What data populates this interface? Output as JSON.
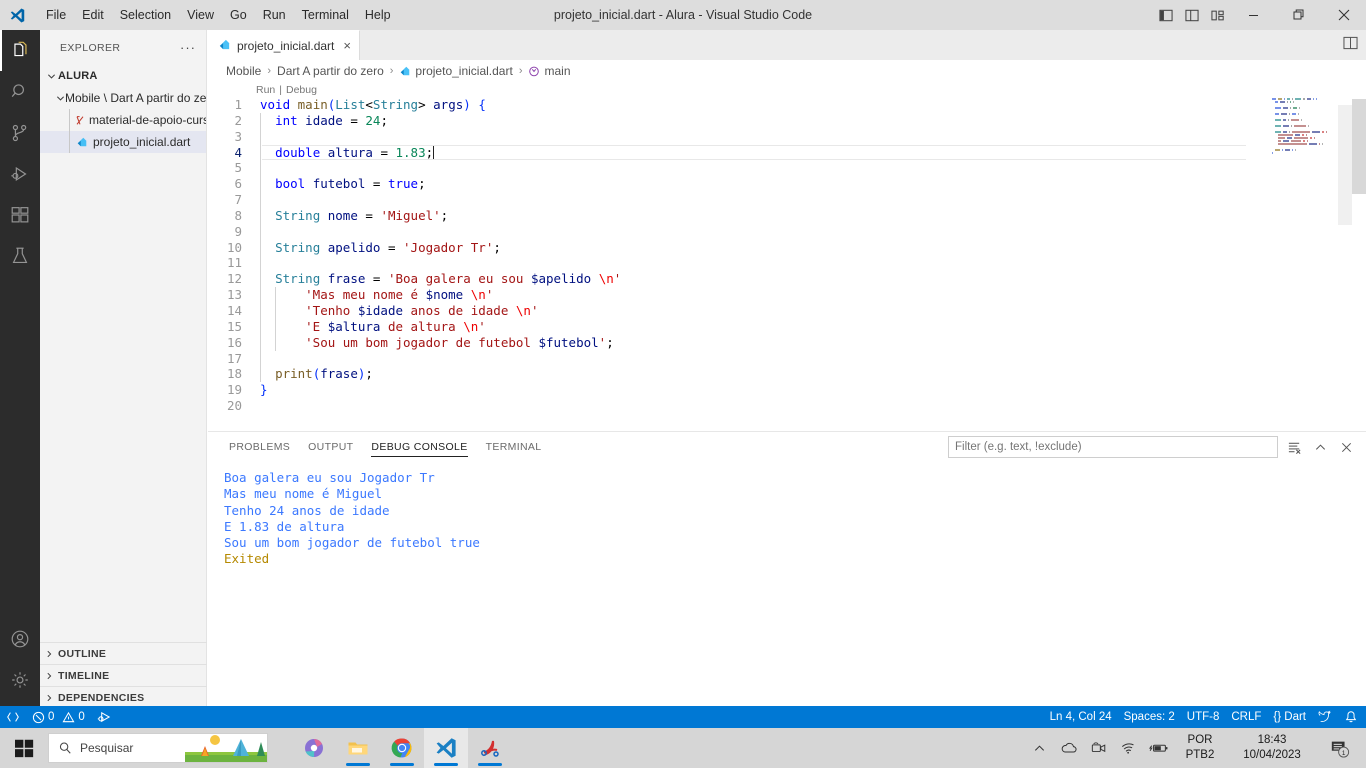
{
  "titlebar": {
    "title": "projeto_inicial.dart - Alura - Visual Studio Code",
    "logo_icon": "vscode-logo-icon",
    "menus": [
      "File",
      "Edit",
      "Selection",
      "View",
      "Go",
      "Run",
      "Terminal",
      "Help"
    ],
    "layout_icons": [
      "toggle-primary-sidebar-icon",
      "toggle-panel-icon",
      "toggle-secondary-sidebar-icon",
      "customize-layout-icon"
    ],
    "window_controls": [
      "minimize-icon",
      "maximize-icon",
      "close-icon"
    ]
  },
  "activitybar": {
    "items": [
      {
        "name": "explorer",
        "icon": "files-icon",
        "active": true
      },
      {
        "name": "search",
        "icon": "search-icon",
        "active": false
      },
      {
        "name": "source-control",
        "icon": "source-control-icon",
        "active": false
      },
      {
        "name": "run-and-debug",
        "icon": "run-debug-icon",
        "active": false
      },
      {
        "name": "extensions",
        "icon": "extensions-icon",
        "active": false
      },
      {
        "name": "testing",
        "icon": "beaker-icon",
        "active": false
      }
    ],
    "bottom": [
      {
        "name": "accounts",
        "icon": "account-icon"
      },
      {
        "name": "manage",
        "icon": "gear-icon"
      }
    ]
  },
  "sidebar": {
    "header_title": "EXPLORER",
    "header_more": "···",
    "root": "ALURA",
    "folder": "Mobile \\ Dart A partir do ze...",
    "files": [
      {
        "label": "material-de-apoio-curso-...",
        "icon": "pdf-icon",
        "selected": false
      },
      {
        "label": "projeto_inicial.dart",
        "icon": "dart-icon",
        "selected": true
      }
    ],
    "sections": [
      "OUTLINE",
      "TIMELINE",
      "DEPENDENCIES"
    ]
  },
  "editor": {
    "tab": {
      "label": "projeto_inicial.dart",
      "icon": "dart-icon",
      "close": "×"
    },
    "split_icon": "split-editor-icon",
    "breadcrumb": [
      "Mobile",
      "Dart A partir do zero",
      "projeto_inicial.dart",
      "main"
    ],
    "breadcrumb_file_icon": "dart-icon",
    "breadcrumb_symbol_icon": "symbol-method-icon",
    "codelens": {
      "run": "Run",
      "sep": "|",
      "debug": "Debug"
    },
    "current_line": 4,
    "lines": [
      {
        "n": 1,
        "indent": 0,
        "tokens": [
          {
            "t": "void",
            "c": "key"
          },
          {
            "t": " ",
            "c": "plain"
          },
          {
            "t": "main",
            "c": "fn"
          },
          {
            "t": "(",
            "c": "brkt1"
          },
          {
            "t": "List",
            "c": "type"
          },
          {
            "t": "<",
            "c": "op"
          },
          {
            "t": "String",
            "c": "type"
          },
          {
            "t": "> ",
            "c": "op"
          },
          {
            "t": "args",
            "c": "var"
          },
          {
            "t": ")",
            "c": "brkt1"
          },
          {
            "t": " ",
            "c": "plain"
          },
          {
            "t": "{",
            "c": "brkt1"
          }
        ]
      },
      {
        "n": 2,
        "indent": 1,
        "tokens": [
          {
            "t": "  ",
            "c": "plain"
          },
          {
            "t": "int",
            "c": "key"
          },
          {
            "t": " ",
            "c": "plain"
          },
          {
            "t": "idade",
            "c": "var"
          },
          {
            "t": " ",
            "c": "plain"
          },
          {
            "t": "=",
            "c": "op"
          },
          {
            "t": " ",
            "c": "plain"
          },
          {
            "t": "24",
            "c": "num"
          },
          {
            "t": ";",
            "c": "plain"
          }
        ]
      },
      {
        "n": 3,
        "indent": 1,
        "tokens": []
      },
      {
        "n": 4,
        "indent": 1,
        "tokens": [
          {
            "t": "  ",
            "c": "plain"
          },
          {
            "t": "double",
            "c": "key"
          },
          {
            "t": " ",
            "c": "plain"
          },
          {
            "t": "altura",
            "c": "var"
          },
          {
            "t": " ",
            "c": "plain"
          },
          {
            "t": "=",
            "c": "op"
          },
          {
            "t": " ",
            "c": "plain"
          },
          {
            "t": "1.83",
            "c": "num"
          },
          {
            "t": ";",
            "c": "plain"
          }
        ]
      },
      {
        "n": 5,
        "indent": 1,
        "tokens": []
      },
      {
        "n": 6,
        "indent": 1,
        "tokens": [
          {
            "t": "  ",
            "c": "plain"
          },
          {
            "t": "bool",
            "c": "key"
          },
          {
            "t": " ",
            "c": "plain"
          },
          {
            "t": "futebol",
            "c": "var"
          },
          {
            "t": " ",
            "c": "plain"
          },
          {
            "t": "=",
            "c": "op"
          },
          {
            "t": " ",
            "c": "plain"
          },
          {
            "t": "true",
            "c": "key"
          },
          {
            "t": ";",
            "c": "plain"
          }
        ]
      },
      {
        "n": 7,
        "indent": 1,
        "tokens": []
      },
      {
        "n": 8,
        "indent": 1,
        "tokens": [
          {
            "t": "  ",
            "c": "plain"
          },
          {
            "t": "String",
            "c": "type"
          },
          {
            "t": " ",
            "c": "plain"
          },
          {
            "t": "nome",
            "c": "var"
          },
          {
            "t": " ",
            "c": "plain"
          },
          {
            "t": "=",
            "c": "op"
          },
          {
            "t": " ",
            "c": "plain"
          },
          {
            "t": "'Miguel'",
            "c": "str"
          },
          {
            "t": ";",
            "c": "plain"
          }
        ]
      },
      {
        "n": 9,
        "indent": 1,
        "tokens": []
      },
      {
        "n": 10,
        "indent": 1,
        "tokens": [
          {
            "t": "  ",
            "c": "plain"
          },
          {
            "t": "String",
            "c": "type"
          },
          {
            "t": " ",
            "c": "plain"
          },
          {
            "t": "apelido",
            "c": "var"
          },
          {
            "t": " ",
            "c": "plain"
          },
          {
            "t": "=",
            "c": "op"
          },
          {
            "t": " ",
            "c": "plain"
          },
          {
            "t": "'Jogador Tr'",
            "c": "str"
          },
          {
            "t": ";",
            "c": "plain"
          }
        ]
      },
      {
        "n": 11,
        "indent": 1,
        "tokens": []
      },
      {
        "n": 12,
        "indent": 1,
        "tokens": [
          {
            "t": "  ",
            "c": "plain"
          },
          {
            "t": "String",
            "c": "type"
          },
          {
            "t": " ",
            "c": "plain"
          },
          {
            "t": "frase",
            "c": "var"
          },
          {
            "t": " ",
            "c": "plain"
          },
          {
            "t": "=",
            "c": "op"
          },
          {
            "t": " ",
            "c": "plain"
          },
          {
            "t": "'Boa galera eu sou ",
            "c": "str"
          },
          {
            "t": "$apelido",
            "c": "var"
          },
          {
            "t": " ",
            "c": "str"
          },
          {
            "t": "\\n",
            "c": "esc"
          },
          {
            "t": "'",
            "c": "str"
          }
        ]
      },
      {
        "n": 13,
        "indent": 2,
        "tokens": [
          {
            "t": "      ",
            "c": "plain"
          },
          {
            "t": "'Mas meu nome é ",
            "c": "str"
          },
          {
            "t": "$nome",
            "c": "var"
          },
          {
            "t": " ",
            "c": "str"
          },
          {
            "t": "\\n",
            "c": "esc"
          },
          {
            "t": "'",
            "c": "str"
          }
        ]
      },
      {
        "n": 14,
        "indent": 2,
        "tokens": [
          {
            "t": "      ",
            "c": "plain"
          },
          {
            "t": "'Tenho ",
            "c": "str"
          },
          {
            "t": "$idade",
            "c": "var"
          },
          {
            "t": " anos de idade ",
            "c": "str"
          },
          {
            "t": "\\n",
            "c": "esc"
          },
          {
            "t": "'",
            "c": "str"
          }
        ]
      },
      {
        "n": 15,
        "indent": 2,
        "tokens": [
          {
            "t": "      ",
            "c": "plain"
          },
          {
            "t": "'E ",
            "c": "str"
          },
          {
            "t": "$altura",
            "c": "var"
          },
          {
            "t": " de altura ",
            "c": "str"
          },
          {
            "t": "\\n",
            "c": "esc"
          },
          {
            "t": "'",
            "c": "str"
          }
        ]
      },
      {
        "n": 16,
        "indent": 2,
        "tokens": [
          {
            "t": "      ",
            "c": "plain"
          },
          {
            "t": "'Sou um bom jogador de futebol ",
            "c": "str"
          },
          {
            "t": "$futebol",
            "c": "var"
          },
          {
            "t": "'",
            "c": "str"
          },
          {
            "t": ";",
            "c": "plain"
          }
        ]
      },
      {
        "n": 17,
        "indent": 1,
        "tokens": []
      },
      {
        "n": 18,
        "indent": 1,
        "tokens": [
          {
            "t": "  ",
            "c": "plain"
          },
          {
            "t": "print",
            "c": "fn"
          },
          {
            "t": "(",
            "c": "brkt1"
          },
          {
            "t": "frase",
            "c": "var"
          },
          {
            "t": ")",
            "c": "brkt1"
          },
          {
            "t": ";",
            "c": "plain"
          }
        ]
      },
      {
        "n": 19,
        "indent": 0,
        "tokens": [
          {
            "t": "}",
            "c": "brkt1"
          }
        ]
      },
      {
        "n": 20,
        "indent": 0,
        "tokens": []
      }
    ]
  },
  "panel": {
    "tabs": [
      {
        "label": "PROBLEMS",
        "active": false
      },
      {
        "label": "OUTPUT",
        "active": false
      },
      {
        "label": "DEBUG CONSOLE",
        "active": true
      },
      {
        "label": "TERMINAL",
        "active": false
      }
    ],
    "filter_placeholder": "Filter (e.g. text, !exclude)",
    "filter_value": "",
    "actions": [
      "clear-console-icon",
      "chevron-up-icon",
      "close-panel-icon"
    ],
    "output": [
      {
        "text": "Boa galera eu sou Jogador Tr",
        "kind": "stdout"
      },
      {
        "text": "Mas meu nome é Miguel",
        "kind": "stdout"
      },
      {
        "text": "Tenho 24 anos de idade",
        "kind": "stdout"
      },
      {
        "text": "E 1.83 de altura",
        "kind": "stdout"
      },
      {
        "text": "Sou um bom jogador de futebol true",
        "kind": "stdout"
      },
      {
        "text": "Exited",
        "kind": "exit"
      }
    ]
  },
  "statusbar": {
    "accent": "#0078d4",
    "left": [
      {
        "name": "remote-indicator",
        "icon": "remote-icon",
        "label": ""
      },
      {
        "name": "errors",
        "icon": "error-icon",
        "label": "0"
      },
      {
        "name": "warnings",
        "icon": "warning-icon",
        "label": "0"
      },
      {
        "name": "dart-devtools",
        "icon": "dart-run-icon",
        "label": ""
      }
    ],
    "right": [
      {
        "name": "cursor-position",
        "label": "Ln 4, Col 24"
      },
      {
        "name": "indentation",
        "label": "Spaces: 2"
      },
      {
        "name": "encoding",
        "label": "UTF-8"
      },
      {
        "name": "eol",
        "label": "CRLF"
      },
      {
        "name": "language-mode",
        "label": "{} Dart"
      },
      {
        "name": "feedback",
        "icon": "tweet-icon",
        "label": ""
      },
      {
        "name": "notifications",
        "icon": "bell-icon",
        "label": ""
      }
    ]
  },
  "taskbar": {
    "start_icon": "windows-start-icon",
    "search_placeholder": "Pesquisar",
    "search_icon": "search-icon",
    "apps": [
      {
        "name": "microsoft-365",
        "running": false,
        "active": false
      },
      {
        "name": "file-explorer",
        "running": true,
        "active": false
      },
      {
        "name": "google-chrome",
        "running": true,
        "active": false
      },
      {
        "name": "visual-studio-code",
        "running": true,
        "active": true
      },
      {
        "name": "acrobat-reader",
        "running": true,
        "active": false
      }
    ],
    "tray_icons": [
      "show-hidden-icons-icon",
      "onedrive-icon",
      "meet-now-icon",
      "network-icon",
      "battery-icon"
    ],
    "language": {
      "line1": "POR",
      "line2": "PTB2"
    },
    "clock": {
      "time": "18:43",
      "date": "10/04/2023"
    },
    "notification_count": "1",
    "notification_icon": "notification-center-icon"
  }
}
